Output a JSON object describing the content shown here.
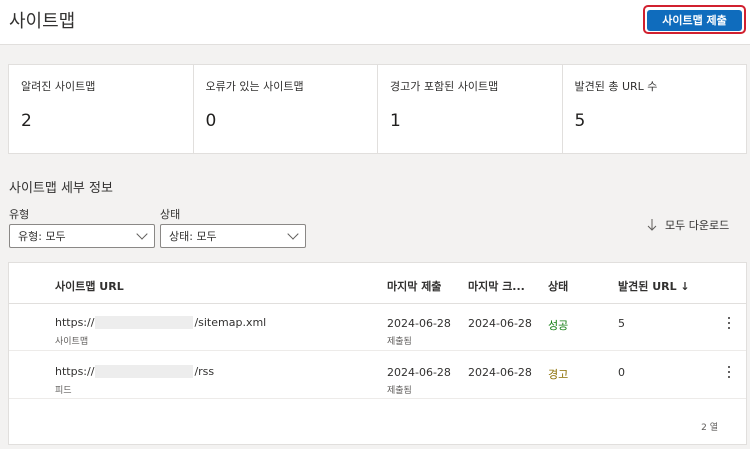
{
  "header": {
    "title": "사이트맵",
    "submit_label": "사이트맵 제출"
  },
  "stats": [
    {
      "label": "알려진 사이트맵",
      "value": "2"
    },
    {
      "label": "오류가 있는 사이트맵",
      "value": "0"
    },
    {
      "label": "경고가 포함된 사이트맵",
      "value": "1"
    },
    {
      "label": "발견된 총 URL 수",
      "value": "5"
    }
  ],
  "details": {
    "title": "사이트맵 세부 정보",
    "filters": {
      "type": {
        "label": "유형",
        "value": "유형: 모두"
      },
      "status": {
        "label": "상태",
        "value": "상태: 모두"
      }
    },
    "download_label": "모두 다운로드"
  },
  "table": {
    "columns": [
      "사이트맵 URL",
      "마지막 제출",
      "마지막 크...",
      "상태",
      "발견된 URL ↓"
    ],
    "rows": [
      {
        "url_prefix": "https://",
        "url_suffix": "/sitemap.xml",
        "type": "사이트맵",
        "submitted": "2024-06-28",
        "submitted_sub": "제출됨",
        "last_read": "2024-06-28",
        "status": "성공",
        "found": "5"
      },
      {
        "url_prefix": "https://",
        "url_suffix": "/rss",
        "type": "피드",
        "submitted": "2024-06-28",
        "submitted_sub": "제출됨",
        "last_read": "2024-06-28",
        "status": "경고",
        "found": "0"
      }
    ],
    "row_count": "2 열"
  }
}
